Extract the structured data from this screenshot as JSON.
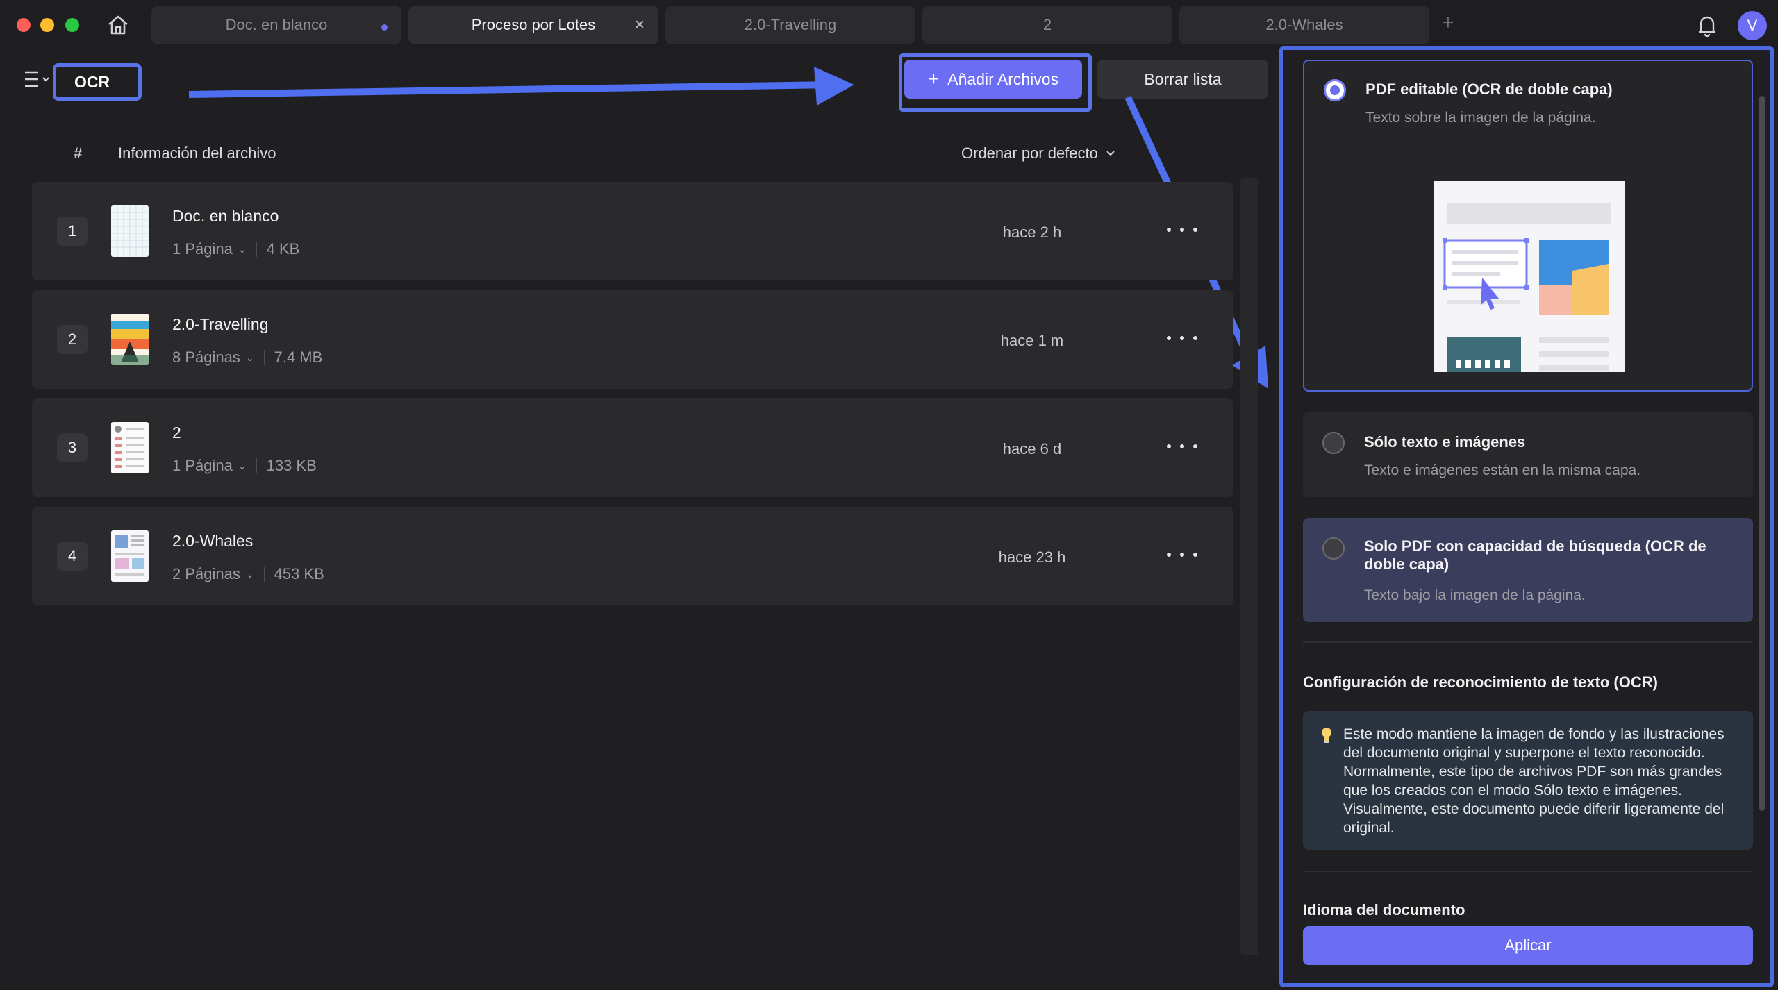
{
  "tabs": [
    {
      "label": "Doc. en blanco",
      "active": false,
      "unsaved_dot": true
    },
    {
      "label": "Proceso por Lotes",
      "active": true,
      "closable": true
    },
    {
      "label": "2.0-Travelling",
      "active": false
    },
    {
      "label": "2",
      "active": false
    },
    {
      "label": "2.0-Whales",
      "active": false
    }
  ],
  "tab_add_label": "+",
  "tab_close_label": "×",
  "user": {
    "avatar_initial": "V"
  },
  "toolbar": {
    "mode_label": "OCR",
    "add_files_label": "Añadir Archivos",
    "add_files_icon": "+",
    "clear_list_label": "Borrar lista"
  },
  "list": {
    "col_number": "#",
    "col_info": "Información del archivo",
    "sort_label": "Ordenar por defecto",
    "files": [
      {
        "index": "1",
        "name": "Doc. en blanco",
        "pages": "1 Página",
        "size": "4 KB",
        "time": "hace 2 h"
      },
      {
        "index": "2",
        "name": "2.0-Travelling",
        "pages": "8 Páginas",
        "size": "7.4 MB",
        "time": "hace 1 m"
      },
      {
        "index": "3",
        "name": "2",
        "pages": "1 Página",
        "size": "133 KB",
        "time": "hace 6 d"
      },
      {
        "index": "4",
        "name": "2.0-Whales",
        "pages": "2 Páginas",
        "size": "453 KB",
        "time": "hace 23 h"
      }
    ]
  },
  "panel": {
    "options": [
      {
        "title": "PDF editable (OCR de doble capa)",
        "desc": "Texto sobre la imagen de la página.",
        "selected": true
      },
      {
        "title": "Sólo texto e imágenes",
        "desc": "Texto e imágenes están en la misma capa.",
        "selected": false
      },
      {
        "title": "Solo PDF con capacidad de búsqueda (OCR de doble capa)",
        "desc": "Texto bajo la imagen de la página.",
        "selected": false
      }
    ],
    "ocr_settings_title": "Configuración de reconocimiento de texto (OCR)",
    "ocr_info": "Este modo mantiene la imagen de fondo y las ilustraciones del documento original y superpone el texto reconocido. Normalmente, este tipo de archivos PDF son más grandes que los creados con el modo Sólo texto e imágenes. Visualmente, este documento puede diferir ligeramente del original.",
    "language_title": "Idioma del documento",
    "apply_label": "Aplicar"
  },
  "colors": {
    "accent": "#6b6ef2",
    "highlight_border": "#4b69e0",
    "background": "#1f1f22"
  }
}
